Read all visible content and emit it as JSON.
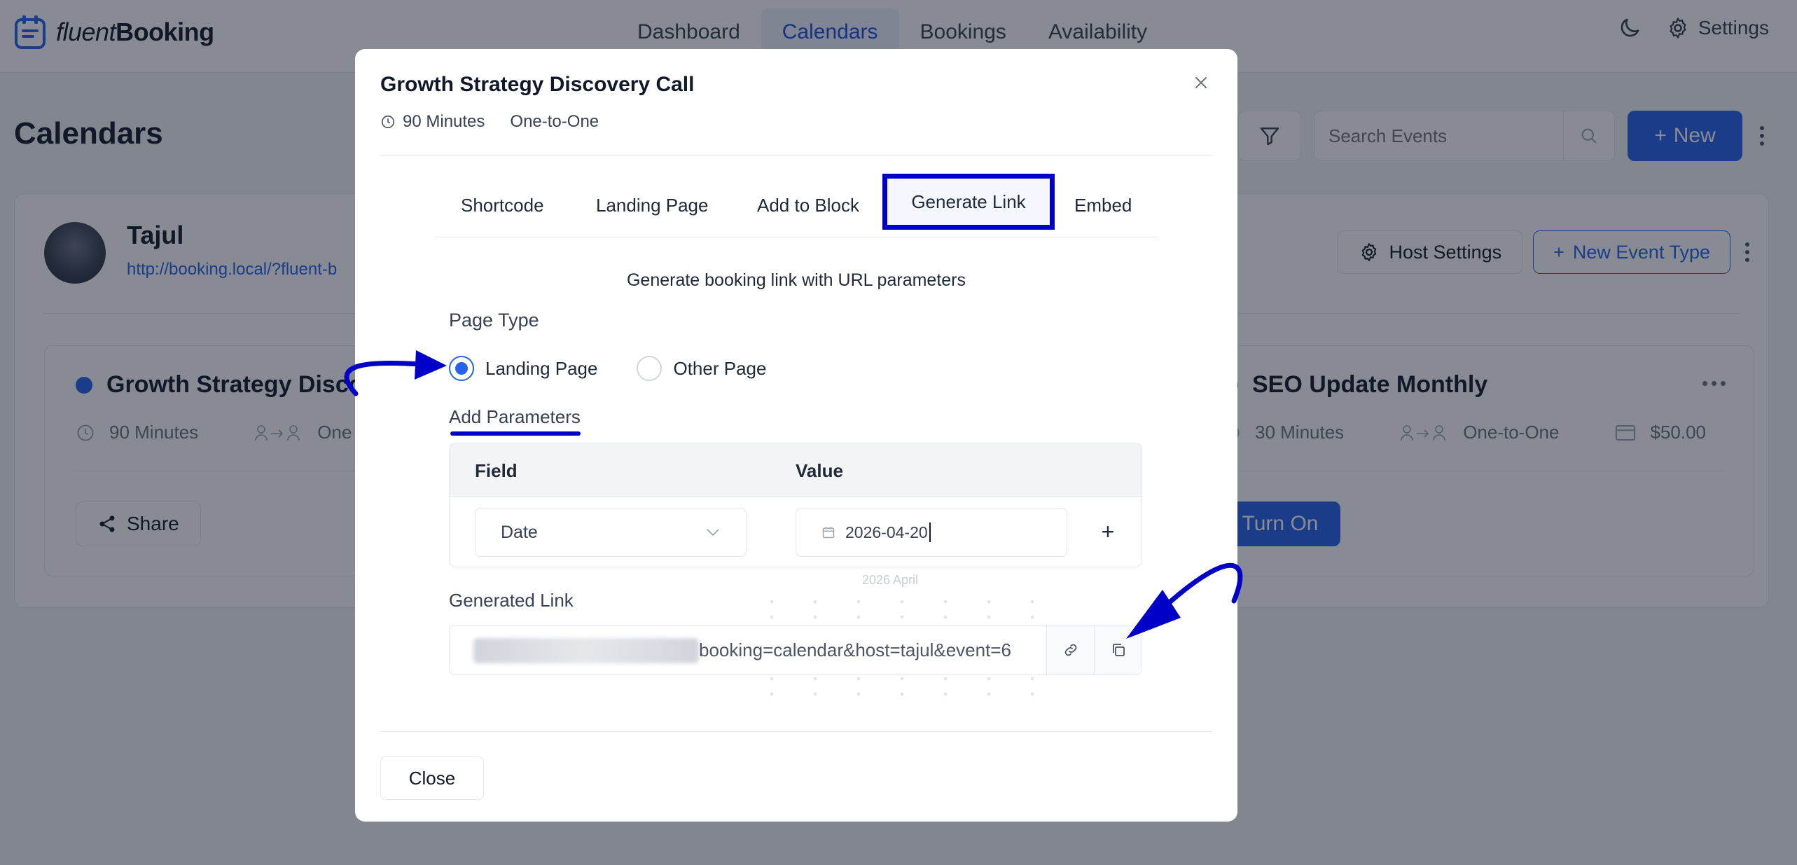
{
  "app": {
    "logo_prefix": "fluent",
    "logo_suffix": "Booking",
    "nav": [
      {
        "label": "Dashboard",
        "active": false
      },
      {
        "label": "Calendars",
        "active": true
      },
      {
        "label": "Bookings",
        "active": false
      },
      {
        "label": "Availability",
        "active": false
      }
    ],
    "settings_label": "Settings"
  },
  "page": {
    "title": "Calendars",
    "search_placeholder": "Search Events",
    "new_label": "New"
  },
  "host": {
    "name": "Tajul",
    "link": "http://booking.local/?fluent-b",
    "host_settings_label": "Host Settings",
    "new_event_type_label": "New Event Type"
  },
  "events": [
    {
      "title": "Growth Strategy Disco",
      "duration": "90 Minutes",
      "type": "One",
      "action": "Share"
    },
    {
      "title": "SEO Update Monthly",
      "duration": "30 Minutes",
      "type": "One-to-One",
      "price": "$50.00",
      "action": "Turn On"
    }
  ],
  "modal": {
    "title": "Growth Strategy Discovery Call",
    "duration": "90 Minutes",
    "meeting_type": "One-to-One",
    "tabs": [
      "Shortcode",
      "Landing Page",
      "Add to Block",
      "Generate Link",
      "Embed"
    ],
    "active_tab": "Generate Link",
    "description": "Generate booking link with URL parameters",
    "page_type_label": "Page Type",
    "page_type_options": [
      {
        "label": "Landing Page",
        "selected": true
      },
      {
        "label": "Other Page",
        "selected": false
      }
    ],
    "add_parameters_label": "Add Parameters",
    "table_headers": {
      "field": "Field",
      "value": "Value"
    },
    "param_field": "Date",
    "param_value": "2026-04-20",
    "calendar_popup_title": "2026 April",
    "generated_link_label": "Generated Link",
    "generated_link_text": "booking=calendar&host=tajul&event=6",
    "close_label": "Close"
  },
  "colors": {
    "accent": "#2563eb",
    "annotation": "#0000c8"
  }
}
